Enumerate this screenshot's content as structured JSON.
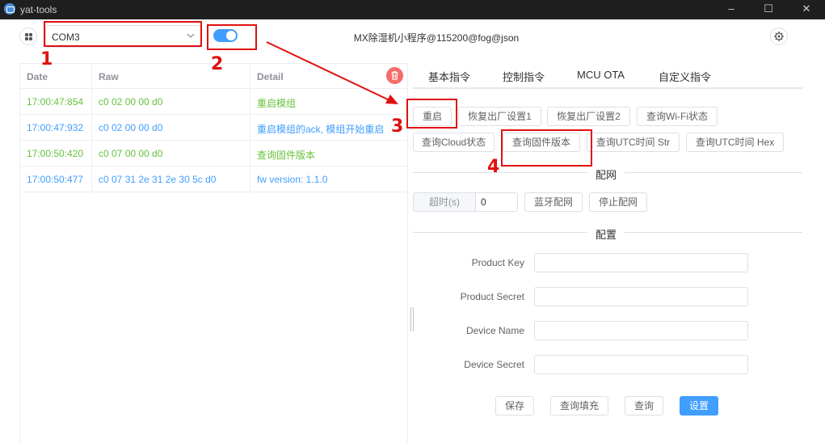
{
  "window": {
    "title": "yat-tools",
    "minimize": "–",
    "maximize": "☐",
    "close": "✕"
  },
  "header": {
    "port_value": "COM3",
    "center_title": "MX除湿机小程序@115200@fog@json"
  },
  "log": {
    "columns": [
      "Date",
      "Raw",
      "Detail"
    ],
    "rows": [
      {
        "date": "17:00:47:854",
        "raw": "c0 02 00 00 d0",
        "detail": "重启模组",
        "color": "#67c23a"
      },
      {
        "date": "17:00:47:932",
        "raw": "c0 02 00 00 d0",
        "detail": "重启模组的ack, 模组开始重启",
        "color": "#409eff"
      },
      {
        "date": "17:00:50:420",
        "raw": "c0 07 00 00 d0",
        "detail": "查询固件版本",
        "color": "#67c23a"
      },
      {
        "date": "17:00:50:477",
        "raw": "c0 07 31 2e 31 2e 30 5c d0",
        "detail": "fw version: 1.1.0",
        "color": "#409eff"
      }
    ]
  },
  "tabs": [
    "基本指令",
    "控制指令",
    "MCU OTA",
    "自定义指令"
  ],
  "commands": {
    "restart": "重启",
    "factory1": "恢复出厂设置1",
    "factory2": "恢复出厂设置2",
    "wifi_status": "查询Wi-Fi状态",
    "cloud_status": "查询Cloud状态",
    "fw_version": "查询固件版本",
    "utc_str": "查询UTC时间 Str",
    "utc_hex": "查询UTC时间 Hex"
  },
  "provision": {
    "section_title": "配网",
    "timeout_label": "超时(s)",
    "timeout_value": "0",
    "bt_button": "蓝牙配网",
    "stop_button": "停止配网"
  },
  "config": {
    "section_title": "配置",
    "product_key_label": "Product Key",
    "product_secret_label": "Product Secret",
    "device_name_label": "Device Name",
    "device_secret_label": "Device Secret",
    "product_key": "",
    "product_secret": "",
    "device_name": "",
    "device_secret": "",
    "save_button": "保存",
    "query_fill_button": "查询填充",
    "query_button": "查询",
    "set_button": "设置"
  },
  "annotations": [
    "1",
    "2",
    "3",
    "4"
  ],
  "colors": {
    "accent": "#409eff",
    "success": "#67c23a",
    "danger": "#f56c6c",
    "annotation": "#e01010"
  }
}
